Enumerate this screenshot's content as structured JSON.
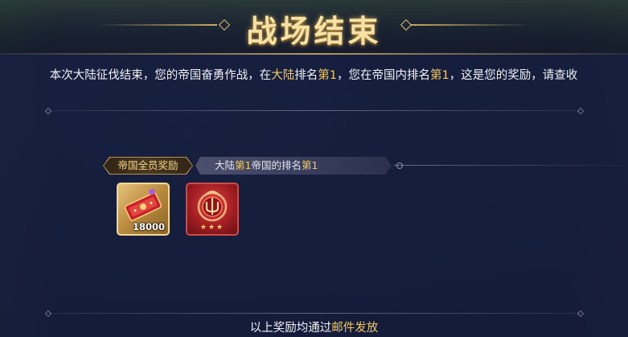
{
  "header": {
    "title": "战场结束"
  },
  "description": {
    "part1": "本次大陆征伐结束，您的帝国奋勇作战，在",
    "hl1": "大陆",
    "hl2": "第1",
    "part2": "，您在帝国内排名",
    "hl3": "第1",
    "part3": "，这是您的奖励，请查收"
  },
  "reward_tabs": {
    "tab1_label": "帝国全员奖励",
    "tab2_prefix": "大陆",
    "tab2_hl1": "第1",
    "tab2_mid": "帝国的排名",
    "tab2_hl2": "第1"
  },
  "rewards": [
    {
      "icon": "ticket-icon",
      "count": "18000"
    },
    {
      "icon": "emblem-icon",
      "stars": "★★★"
    }
  ],
  "footer": {
    "prefix": "以上奖励均通过",
    "highlight": "邮件发放"
  },
  "colors": {
    "highlight": "#f4c95a",
    "title": "#f7e2a6",
    "panel": "#1a2344"
  }
}
